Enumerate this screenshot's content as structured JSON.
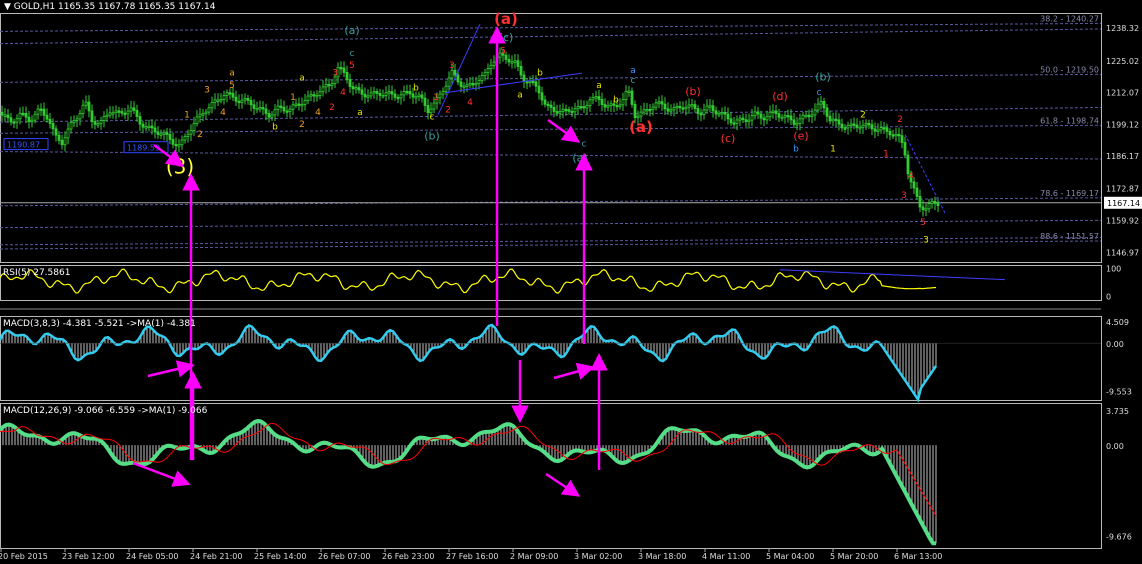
{
  "colors": {
    "bg": "#000000",
    "candle": "#33cc33",
    "fib": "#5a5aa0",
    "rsi": "#ffff00",
    "macd_line": "#33ccee",
    "signal": "#ff0000",
    "hist": "#c0c0c0",
    "arrow": "#ff00ff",
    "trend": "#3d3dff",
    "label_orange": "#f0a020",
    "label_red": "#ff3030",
    "label_teal": "#3aa0a0",
    "label_yellow": "#e6e600",
    "label_blue": "#3399ff"
  },
  "header": {
    "symbol": "GOLD,H1",
    "ohlc": "1165.35 1167.78 1165.35 1167.14",
    "rsi": "RSI(5) 27.5861",
    "macd_fast": "MACD(3,8,3) -4.381 -5.521  ->MA(1) -4.381",
    "macd_slow": "MACD(12,26,9) -9.066 -6.559  ->MA(1) -9.066"
  },
  "chart_data": [
    {
      "type": "candlestick",
      "panel": "price",
      "ylim": [
        1143.0,
        1244.5
      ],
      "y_ticks": [
        1238.32,
        1225.02,
        1212.07,
        1199.12,
        1186.17,
        1172.87,
        1167.14,
        1159.92,
        1146.97
      ],
      "current_price": 1167.14,
      "x_ticks": [
        "20 Feb 2015",
        "23 Feb 12:00",
        "24 Feb 05:00",
        "24 Feb 21:00",
        "25 Feb 14:00",
        "26 Feb 07:00",
        "26 Feb 23:00",
        "27 Feb 16:00",
        "2 Mar 09:00",
        "3 Mar 02:00",
        "3 Mar 18:00",
        "4 Mar 11:00",
        "5 Mar 04:00",
        "5 Mar 20:00",
        "6 Mar 13:00"
      ],
      "fib_levels": [
        {
          "label": "38.2 - 1240.27",
          "value": 1240.27
        },
        {
          "label": "50.0 - 1219.50",
          "value": 1219.5
        },
        {
          "label": "61.8 - 1198.74",
          "value": 1198.74
        },
        {
          "label": "78.6 - 1169.17",
          "value": 1169.17
        },
        {
          "label": "88.6 - 1151.57",
          "value": 1151.57
        }
      ],
      "price_boxes": [
        "1190.87",
        "1189.59"
      ],
      "close_path": [
        [
          0,
          1204
        ],
        [
          10,
          1200
        ],
        [
          20,
          1203
        ],
        [
          30,
          1201
        ],
        [
          40,
          1205
        ],
        [
          48,
          1202
        ],
        [
          55,
          1194
        ],
        [
          62,
          1192
        ],
        [
          70,
          1198
        ],
        [
          78,
          1203
        ],
        [
          85,
          1208
        ],
        [
          92,
          1201
        ],
        [
          100,
          1199
        ],
        [
          110,
          1205
        ],
        [
          120,
          1203
        ],
        [
          130,
          1206
        ],
        [
          140,
          1200
        ],
        [
          150,
          1197
        ],
        [
          160,
          1196
        ],
        [
          170,
          1193
        ],
        [
          180,
          1190
        ],
        [
          188,
          1196
        ],
        [
          195,
          1200
        ],
        [
          205,
          1205
        ],
        [
          215,
          1208
        ],
        [
          225,
          1212
        ],
        [
          232,
          1210
        ],
        [
          240,
          1209
        ],
        [
          250,
          1208
        ],
        [
          260,
          1205
        ],
        [
          270,
          1203
        ],
        [
          280,
          1206
        ],
        [
          290,
          1205
        ],
        [
          300,
          1208
        ],
        [
          310,
          1210
        ],
        [
          320,
          1213
        ],
        [
          330,
          1215
        ],
        [
          338,
          1222
        ],
        [
          346,
          1219
        ],
        [
          352,
          1214
        ],
        [
          360,
          1212
        ],
        [
          370,
          1211
        ],
        [
          380,
          1212
        ],
        [
          392,
          1211
        ],
        [
          400,
          1211
        ],
        [
          410,
          1212
        ],
        [
          420,
          1210
        ],
        [
          428,
          1205
        ],
        [
          436,
          1208
        ],
        [
          445,
          1215
        ],
        [
          452,
          1220
        ],
        [
          460,
          1216
        ],
        [
          468,
          1214
        ],
        [
          476,
          1217
        ],
        [
          485,
          1219
        ],
        [
          492,
          1225
        ],
        [
          500,
          1227
        ],
        [
          508,
          1226
        ],
        [
          515,
          1224
        ],
        [
          523,
          1218
        ],
        [
          530,
          1216
        ],
        [
          538,
          1214
        ],
        [
          546,
          1206
        ],
        [
          555,
          1205
        ],
        [
          565,
          1204
        ],
        [
          575,
          1206
        ],
        [
          583,
          1205
        ],
        [
          590,
          1210
        ],
        [
          598,
          1209
        ],
        [
          606,
          1207
        ],
        [
          614,
          1206
        ],
        [
          622,
          1209
        ],
        [
          628,
          1213
        ],
        [
          635,
          1203
        ],
        [
          645,
          1204
        ],
        [
          655,
          1208
        ],
        [
          665,
          1206
        ],
        [
          675,
          1205
        ],
        [
          685,
          1207
        ],
        [
          692,
          1206
        ],
        [
          700,
          1204
        ],
        [
          710,
          1206
        ],
        [
          718,
          1204
        ],
        [
          726,
          1202
        ],
        [
          735,
          1200
        ],
        [
          745,
          1201
        ],
        [
          755,
          1203
        ],
        [
          765,
          1202
        ],
        [
          775,
          1204
        ],
        [
          785,
          1202
        ],
        [
          795,
          1200
        ],
        [
          805,
          1202
        ],
        [
          815,
          1205
        ],
        [
          822,
          1208
        ],
        [
          830,
          1201
        ],
        [
          840,
          1199
        ],
        [
          850,
          1198
        ],
        [
          860,
          1199
        ],
        [
          870,
          1198
        ],
        [
          880,
          1197
        ],
        [
          890,
          1196
        ],
        [
          898,
          1194
        ],
        [
          904,
          1190
        ],
        [
          908,
          1180
        ],
        [
          912,
          1174
        ],
        [
          916,
          1170
        ],
        [
          920,
          1166
        ],
        [
          926,
          1165
        ],
        [
          933,
          1167
        ],
        [
          938,
          1167.14
        ]
      ],
      "wave_labels": [
        {
          "text": "(a)",
          "color": "teal",
          "x": 352,
          "y": 1236
        },
        {
          "text": "c",
          "color": "teal",
          "x": 352,
          "y": 1227
        },
        {
          "text": "5",
          "color": "red",
          "x": 352,
          "y": 1222
        },
        {
          "text": "3",
          "color": "red",
          "x": 335,
          "y": 1219
        },
        {
          "text": "4",
          "color": "red",
          "x": 343,
          "y": 1211
        },
        {
          "text": "2",
          "color": "red",
          "x": 332,
          "y": 1205
        },
        {
          "text": "a",
          "color": "orange",
          "x": 232,
          "y": 1219
        },
        {
          "text": "5",
          "color": "orange",
          "x": 232,
          "y": 1214
        },
        {
          "text": "3",
          "color": "orange",
          "x": 207,
          "y": 1212
        },
        {
          "text": "4",
          "color": "orange",
          "x": 223,
          "y": 1203
        },
        {
          "text": "1",
          "color": "orange",
          "x": 187,
          "y": 1202
        },
        {
          "text": "2",
          "color": "orange",
          "x": 200,
          "y": 1194
        },
        {
          "text": "b",
          "color": "yellow",
          "x": 275,
          "y": 1197
        },
        {
          "text": "a",
          "color": "yellow",
          "x": 302,
          "y": 1217
        },
        {
          "text": "1",
          "color": "orange",
          "x": 293,
          "y": 1209
        },
        {
          "text": "2",
          "color": "orange",
          "x": 302,
          "y": 1198
        },
        {
          "text": "4",
          "color": "orange",
          "x": 318,
          "y": 1203
        },
        {
          "text": "a",
          "color": "yellow",
          "x": 360,
          "y": 1203
        },
        {
          "text": "b",
          "color": "yellow",
          "x": 416,
          "y": 1213
        },
        {
          "text": "c",
          "color": "yellow",
          "x": 432,
          "y": 1201
        },
        {
          "text": "(b)",
          "color": "teal",
          "x": 432,
          "y": 1193
        },
        {
          "text": "3",
          "color": "red",
          "x": 452,
          "y": 1222
        },
        {
          "text": "1",
          "color": "red",
          "x": 436,
          "y": 1209
        },
        {
          "text": "2",
          "color": "red",
          "x": 448,
          "y": 1204
        },
        {
          "text": "4",
          "color": "red",
          "x": 470,
          "y": 1207
        },
        {
          "text": "(a)",
          "color": "red",
          "x": 506,
          "y": 1240
        },
        {
          "text": "(c)",
          "color": "teal",
          "x": 506,
          "y": 1233
        },
        {
          "text": "5",
          "color": "red",
          "x": 503,
          "y": 1228
        },
        {
          "text": "a",
          "color": "yellow",
          "x": 520,
          "y": 1210
        },
        {
          "text": "b",
          "color": "yellow",
          "x": 540,
          "y": 1219
        },
        {
          "text": "c",
          "color": "teal",
          "x": 584,
          "y": 1190
        },
        {
          "text": "(a)",
          "color": "teal",
          "x": 580,
          "y": 1184
        },
        {
          "text": "a",
          "color": "yellow",
          "x": 599,
          "y": 1214
        },
        {
          "text": "a",
          "color": "blue",
          "x": 633,
          "y": 1220
        },
        {
          "text": "c",
          "color": "teal",
          "x": 633,
          "y": 1216
        },
        {
          "text": "b",
          "color": "yellow",
          "x": 616,
          "y": 1208
        },
        {
          "text": "(a)",
          "color": "red",
          "x": 641,
          "y": 1196
        },
        {
          "text": "(b)",
          "color": "red",
          "x": 693,
          "y": 1211
        },
        {
          "text": "(c)",
          "color": "red",
          "x": 728,
          "y": 1192
        },
        {
          "text": "(d)",
          "color": "red",
          "x": 780,
          "y": 1209
        },
        {
          "text": "(e)",
          "color": "red",
          "x": 801,
          "y": 1193
        },
        {
          "text": "b",
          "color": "blue",
          "x": 796,
          "y": 1188
        },
        {
          "text": "(b)",
          "color": "teal",
          "x": 823,
          "y": 1217
        },
        {
          "text": "c",
          "color": "blue",
          "x": 819,
          "y": 1211
        },
        {
          "text": "2",
          "color": "yellow",
          "x": 863,
          "y": 1202
        },
        {
          "text": "1",
          "color": "yellow",
          "x": 833,
          "y": 1188
        },
        {
          "text": "2",
          "color": "red",
          "x": 900,
          "y": 1200
        },
        {
          "text": "1",
          "color": "red",
          "x": 886,
          "y": 1186
        },
        {
          "text": "4",
          "color": "red",
          "x": 911,
          "y": 1177
        },
        {
          "text": "3",
          "color": "red",
          "x": 904,
          "y": 1169
        },
        {
          "text": "5",
          "color": "red",
          "x": 923,
          "y": 1158
        },
        {
          "text": "3",
          "color": "yellow",
          "x": 926,
          "y": 1151
        }
      ],
      "big_label": {
        "text": "(3)",
        "x": 180,
        "y": 1179
      }
    },
    {
      "type": "line",
      "panel": "rsi",
      "name": "RSI(5)",
      "ylim": [
        -12,
        112
      ],
      "y_ticks": [
        100,
        0
      ],
      "last_value": 27.5861
    },
    {
      "type": "histogram+line",
      "panel": "macd_fast",
      "name": "MACD(3,8,3)",
      "ylim": [
        -11.5,
        5.5
      ],
      "y_ticks": [
        4.509,
        0.0,
        -9.553
      ],
      "values": [
        -4.381,
        -5.521
      ]
    },
    {
      "type": "histogram+line",
      "panel": "macd_slow",
      "name": "MACD(12,26,9)",
      "ylim": [
        -11.0,
        4.5
      ],
      "y_ticks": [
        3.735,
        0.0,
        -9.676
      ],
      "values": [
        -9.066,
        -6.559
      ]
    }
  ]
}
